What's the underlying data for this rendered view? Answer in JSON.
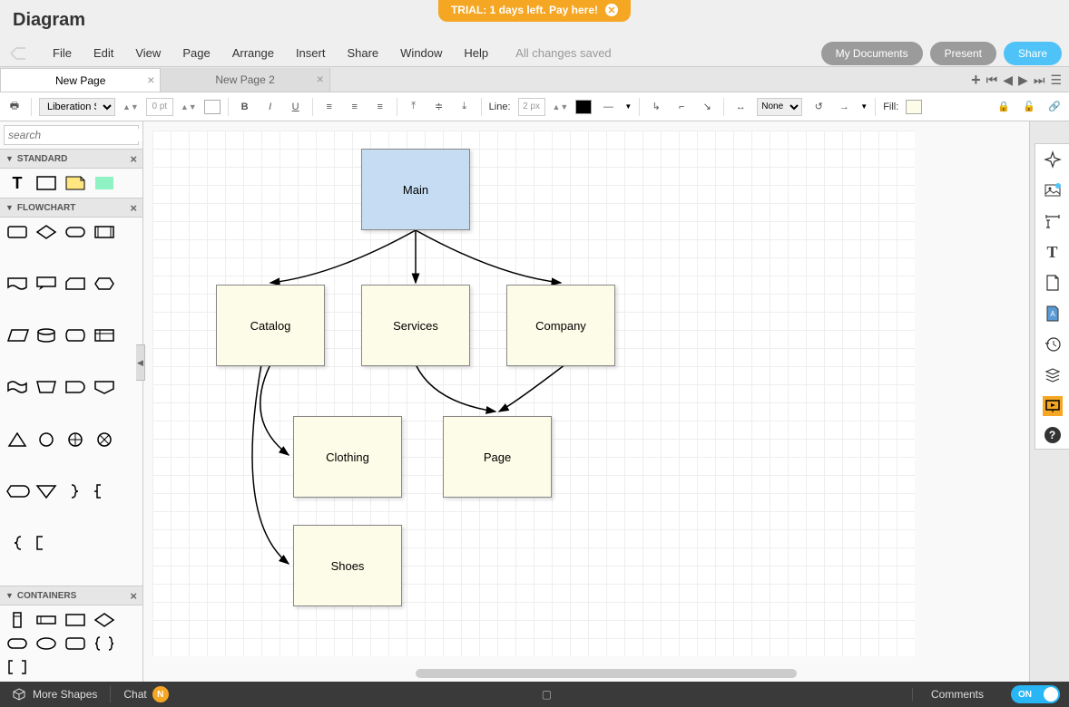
{
  "trial": {
    "text": "TRIAL: 1 days left. Pay here!"
  },
  "title": "Diagram",
  "menu": {
    "items": [
      "File",
      "Edit",
      "View",
      "Page",
      "Arrange",
      "Insert",
      "Share",
      "Window",
      "Help"
    ],
    "status": "All changes saved"
  },
  "buttons": {
    "mydocs": "My Documents",
    "present": "Present",
    "share": "Share"
  },
  "tabs": [
    {
      "label": "New Page",
      "active": true
    },
    {
      "label": "New Page 2",
      "active": false
    }
  ],
  "toolbar": {
    "font": "Liberation S...",
    "fontsize": "0 pt",
    "line_label": "Line:",
    "px": "2 px",
    "arrow": "None",
    "fill": "Fill:"
  },
  "search": {
    "placeholder": "search"
  },
  "panels": {
    "standard": "STANDARD",
    "flowchart": "FLOWCHART",
    "containers": "CONTAINERS"
  },
  "nodes": {
    "main": "Main",
    "catalog": "Catalog",
    "services": "Services",
    "company": "Company",
    "clothing": "Clothing",
    "page": "Page",
    "shoes": "Shoes"
  },
  "bottom": {
    "more": "More Shapes",
    "chat": "Chat",
    "avatar": "N",
    "comments": "Comments",
    "toggle": "ON"
  }
}
